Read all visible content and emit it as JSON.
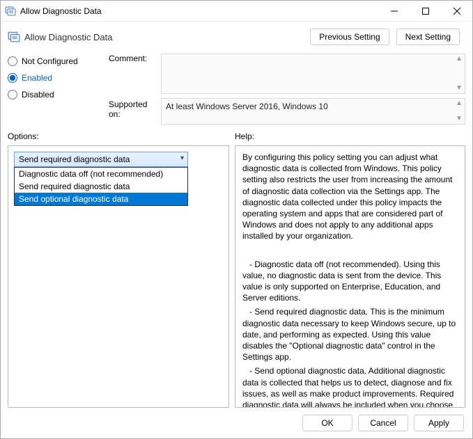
{
  "window": {
    "title": "Allow Diagnostic Data"
  },
  "header": {
    "policy_title": "Allow Diagnostic Data",
    "previous_label": "Previous Setting",
    "next_label": "Next Setting"
  },
  "radios": {
    "not_configured": "Not Configured",
    "enabled": "Enabled",
    "disabled": "Disabled",
    "selected": "enabled"
  },
  "labels": {
    "comment": "Comment:",
    "supported": "Supported on:",
    "options": "Options:",
    "help": "Help:"
  },
  "supported_text": "At least Windows Server 2016, Windows 10",
  "dropdown": {
    "selected_label": "Send required diagnostic data",
    "items": [
      "Diagnostic data off (not recommended)",
      "Send required diagnostic data",
      "Send optional diagnostic data"
    ],
    "highlighted_index": 2
  },
  "help_text": {
    "p1": "By configuring this policy setting you can adjust what diagnostic data is collected from Windows. This policy setting also restricts the user from increasing the amount of diagnostic data collection via the Settings app. The diagnostic data collected under this policy impacts the operating system and apps that are considered part of Windows and does not apply to any additional apps installed by your organization.",
    "p2": "   - Diagnostic data off (not recommended). Using this value, no diagnostic data is sent from the device. This value is only supported on Enterprise, Education, and Server editions.",
    "p3": "   - Send required diagnostic data. This is the minimum diagnostic data necessary to keep Windows secure, up to date, and performing as expected. Using this value disables the \"Optional diagnostic data\" control in the Settings app.",
    "p4": "   - Send optional diagnostic data. Additional diagnostic data is collected that helps us to detect, diagnose and fix issues, as well as make product improvements. Required diagnostic data will always be included when you choose to send optional diagnostic data.  Optional diagnostic data can also include diagnostic log files and crash dumps. Use the \"Limit Dump Collection\" and the"
  },
  "footer": {
    "ok": "OK",
    "cancel": "Cancel",
    "apply": "Apply"
  }
}
